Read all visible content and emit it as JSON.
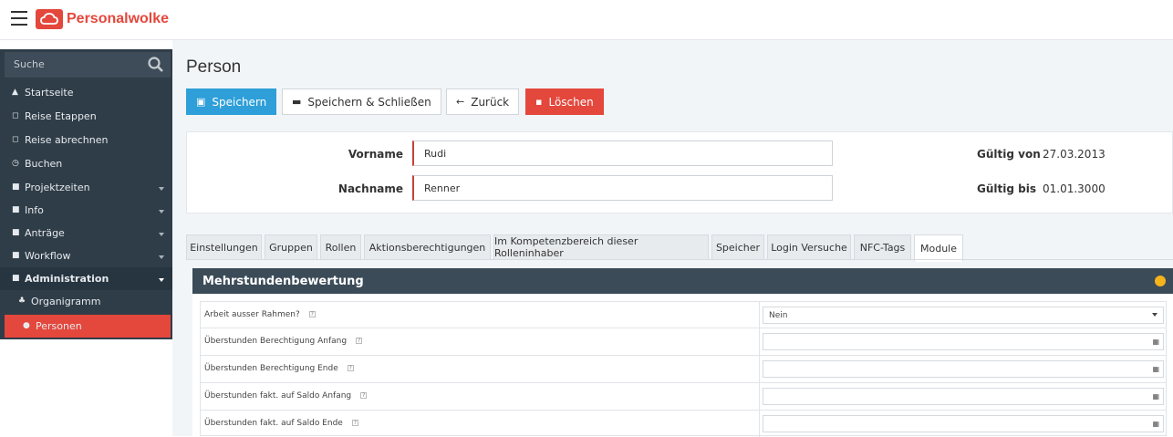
{
  "app": {
    "logo_text": "Personalwolke",
    "brand_color": "#e4473c"
  },
  "sidebar": {
    "search_placeholder": "Suche",
    "items": [
      {
        "label": "Startseite",
        "icon": "home-icon"
      },
      {
        "label": "Reise Etappen",
        "icon": "bookmark-icon"
      },
      {
        "label": "Reise abrechnen",
        "icon": "bookmark-icon"
      },
      {
        "label": "Buchen",
        "icon": "clock-icon"
      },
      {
        "label": "Projektzeiten",
        "icon": "folder-icon"
      },
      {
        "label": "Info",
        "icon": "folder-icon"
      },
      {
        "label": "Anträge",
        "icon": "folder-icon"
      },
      {
        "label": "Workflow",
        "icon": "folder-icon"
      },
      {
        "label": "Administration",
        "icon": "folder-open-icon"
      },
      {
        "label": "Organigramm",
        "icon": "sitemap-icon"
      },
      {
        "label": "Personen",
        "icon": "user-icon"
      }
    ]
  },
  "page": {
    "title": "Person"
  },
  "toolbar": {
    "save_label": "Speichern",
    "save_close_label": "Speichern & Schließen",
    "back_label": "Zurück",
    "delete_label": "Löschen"
  },
  "person": {
    "vorname_label": "Vorname",
    "vorname_value": "Rudi",
    "nachname_label": "Nachname",
    "nachname_value": "Renner",
    "gueltig_von_label": "Gültig von",
    "gueltig_von_value": "27.03.2013",
    "gueltig_bis_label": "Gültig bis",
    "gueltig_bis_value": "01.01.3000"
  },
  "tabs": [
    "Einstellungen",
    "Gruppen",
    "Rollen",
    "Aktionsberechtigungen",
    "Im Kompetenzbereich dieser Rolleninhaber",
    "Speicher",
    "Login Versuche",
    "NFC-Tags",
    "Module"
  ],
  "active_tab": "Module",
  "panel": {
    "title": "Mehrstundenbewertung",
    "rows": [
      {
        "label": "Arbeit ausser Rahmen?",
        "value": "Nein",
        "type": "select"
      },
      {
        "label": "Überstunden Berechtigung Anfang",
        "value": "",
        "type": "date"
      },
      {
        "label": "Überstunden Berechtigung Ende",
        "value": "",
        "type": "date"
      },
      {
        "label": "Überstunden fakt. auf Saldo Anfang",
        "value": "",
        "type": "date"
      },
      {
        "label": "Überstunden fakt. auf Saldo Ende",
        "value": "",
        "type": "date"
      }
    ],
    "help_mark": "?"
  }
}
